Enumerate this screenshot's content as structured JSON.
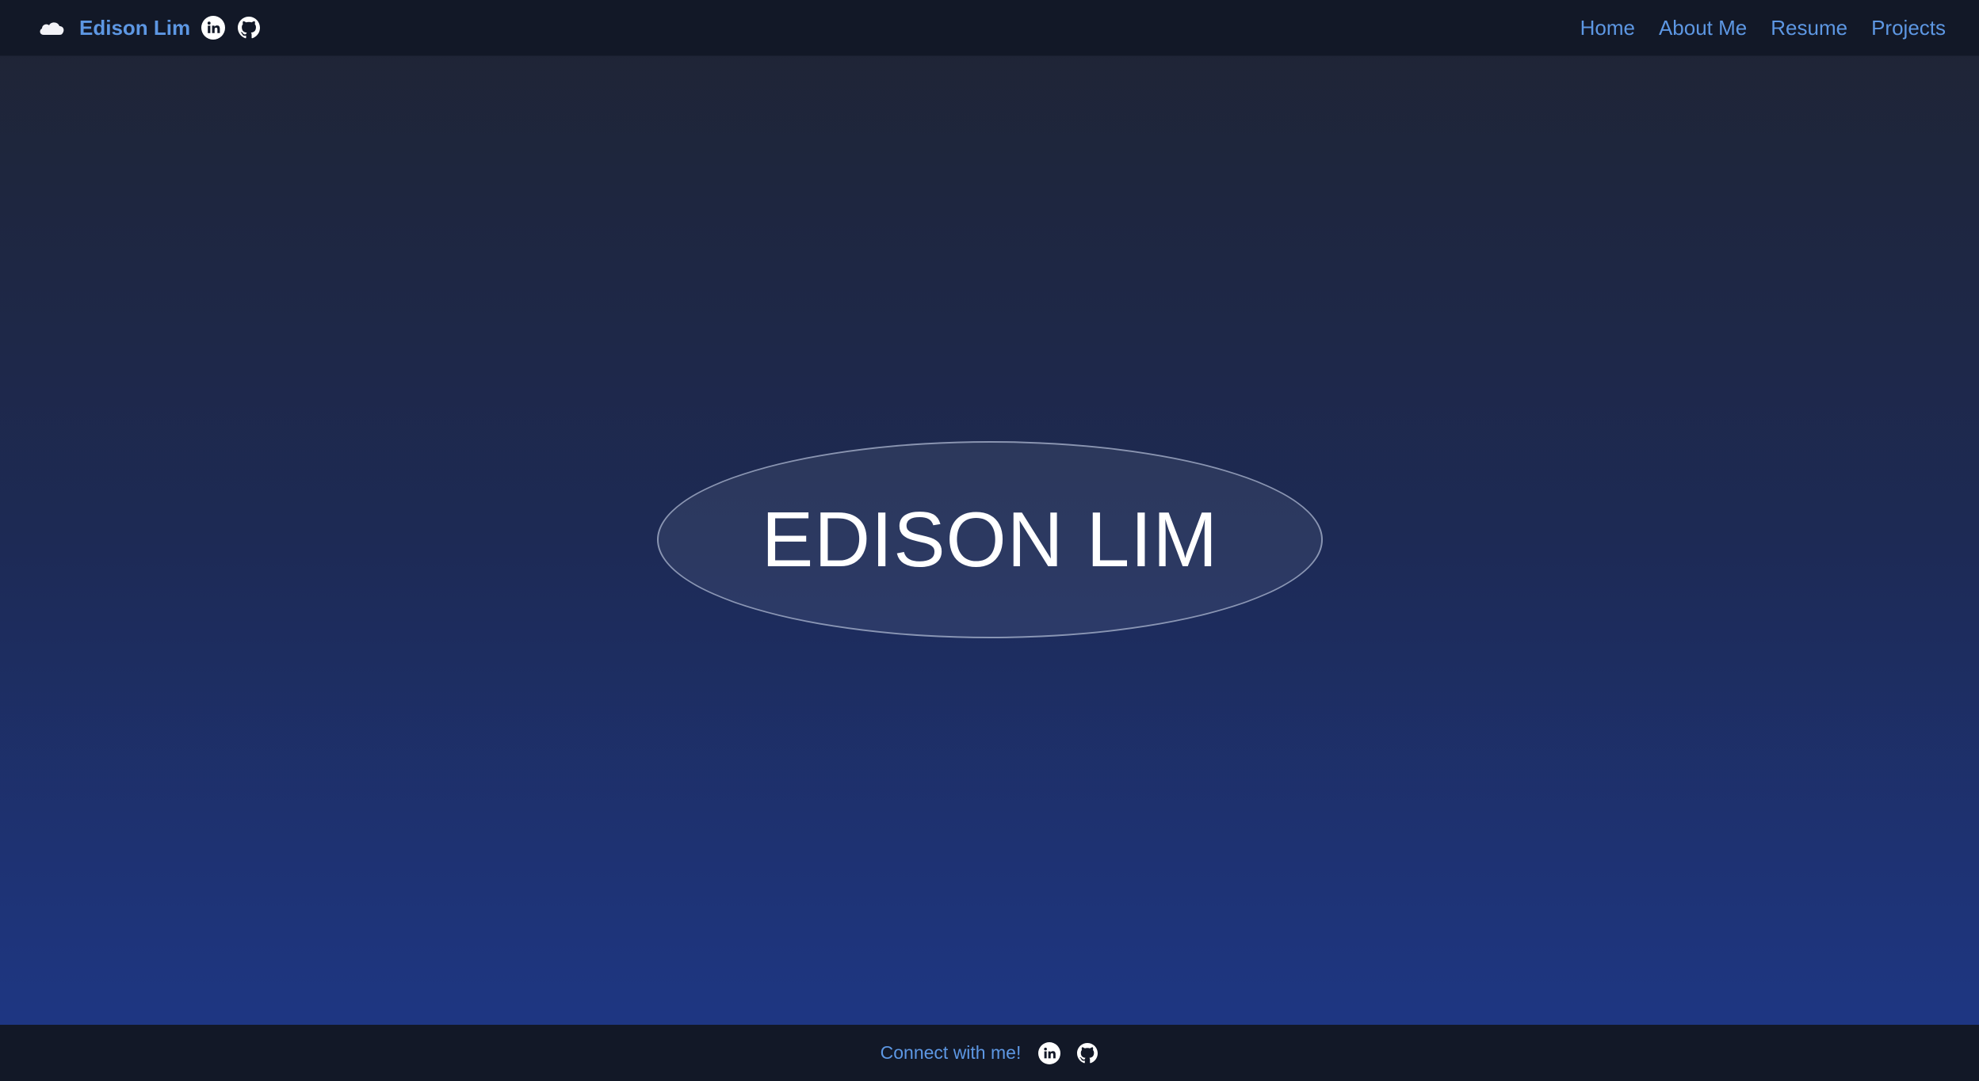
{
  "header": {
    "brand_name": "Edison Lim",
    "logo_icon": "cloud-icon",
    "social": [
      {
        "icon": "linkedin-icon"
      },
      {
        "icon": "github-icon"
      }
    ]
  },
  "nav": {
    "items": [
      {
        "label": "Home"
      },
      {
        "label": "About Me"
      },
      {
        "label": "Resume"
      },
      {
        "label": "Projects"
      }
    ]
  },
  "hero": {
    "title": "EDISON LIM"
  },
  "footer": {
    "text": "Connect with me!",
    "social": [
      {
        "icon": "linkedin-icon"
      },
      {
        "icon": "github-icon"
      }
    ]
  },
  "colors": {
    "accent": "#5d97e3",
    "bar_background": "#121827",
    "gradient_top": "#1f2433",
    "gradient_bottom": "#1e3888"
  }
}
